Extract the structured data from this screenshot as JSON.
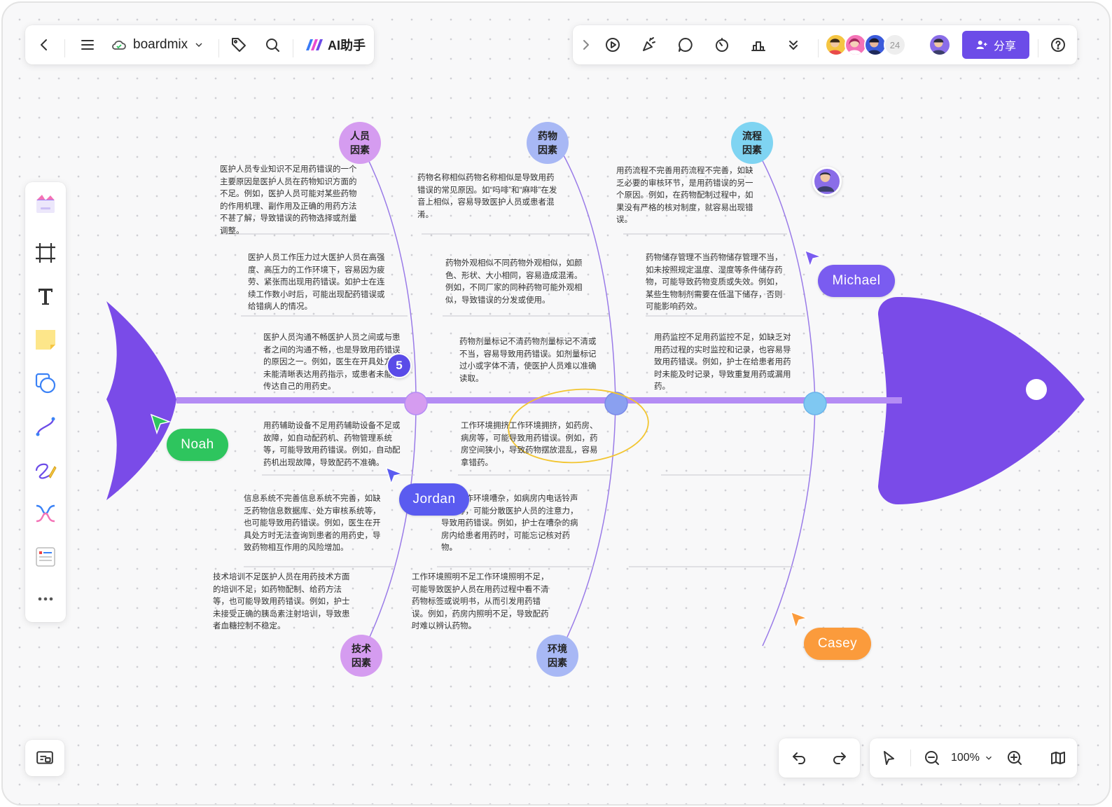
{
  "app": {
    "name": "boardmix",
    "ai_label": "AI助手",
    "share_label": "分享",
    "collaborator_count": "24",
    "accent": "#6c4ce8"
  },
  "colors": {
    "fish": "#7a4be8",
    "spine": "#b48cf4",
    "people": "#d59cf0",
    "drug": "#a8b8f5",
    "process": "#7fd4f2"
  },
  "fishbone": {
    "categories": [
      {
        "label": "人员因素"
      },
      {
        "label": "药物因素"
      },
      {
        "label": "流程因素"
      },
      {
        "label": "技术因素"
      },
      {
        "label": "环境因素"
      }
    ],
    "texts": {
      "p1": "医护人员专业知识不足用药错误的一个主要原因是医护人员在药物知识方面的不足。例如，医护人员可能对某些药物的作用机理、副作用及正确的用药方法不甚了解，导致错误的药物选择或剂量调整。",
      "p2": "医护人员工作压力过大医护人员在高强度、高压力的工作环境下，容易因为疲劳、紧张而出现用药错误。如护士在连续工作数小时后，可能出现配药错误或给错病人的情况。",
      "p3": "医护人员沟通不畅医护人员之间或与患者之间的沟通不畅，也是导致用药错误的原因之一。例如，医生在开具处方时未能清晰表达用药指示，或患者未能确传达自己的用药史。",
      "d1": "药物名称相似药物名称相似是导致用药错误的常见原因。如“吗啡”和“麻啡”在发音上相似，容易导致医护人员或患者混淆。",
      "d2": "药物外观相似不同药物外观相似，如颜色、形状、大小相同，容易造成混淆。例如，不同厂家的同种药物可能外观相似，导致错误的分发或使用。",
      "d3": "药物剂量标记不清药物剂量标记不清或不当，容易导致用药错误。如剂量标记过小或字体不清，使医护人员难以准确读取。",
      "r1": "用药流程不完善用药流程不完善，如缺乏必要的审核环节，是用药错误的另一个原因。例如，在药物配制过程中，如果没有严格的核对制度，就容易出现错误。",
      "r2": "药物储存管理不当药物储存管理不当，如未按照规定温度、湿度等条件储存药物，可能导致药物变质或失效。例如，某些生物制剂需要在低温下储存，否则可能影响药效。",
      "r3": "用药监控不足用药监控不足，如缺乏对用药过程的实时监控和记录，也容易导致用药错误。例如，护士在给患者用药时未能及时记录，导致重复用药或漏用药。",
      "t1": "用药辅助设备不足用药辅助设备不足或故障，如自动配药机、药物管理系统等，可能导致用药错误。例如，自动配药机出现故障，导致配药不准确。",
      "t2": "信息系统不完善信息系统不完善，如缺乏药物信息数据库、处方审核系统等，也可能导致用药错误。例如，医生在开具处方时无法查询到患者的用药史，导致药物相互作用的风险增加。",
      "t3": "技术培训不足医护人员在用药技术方面的培训不足，如药物配制、给药方法等，也可能导致用药错误。例如，护士未接受正确的胰岛素注射培训，导致患者血糖控制不稳定。",
      "e1": "工作环境拥挤工作环境拥挤，如药房、病房等，可能导致用药错误。例如，药房空间狭小，导致药物摆放混乱，容易拿错药。",
      "e2": "嘈杂工作环境嘈杂，如病房内电话铃声不断等，可能分散医护人员的注意力，导致用药错误。例如，护士在嘈杂的病房内给患者用药时，可能忘记核对药物。",
      "e3": "工作环境照明不足工作环境照明不足，可能导致医护人员在用药过程中看不清药物标签或说明书，从而引发用药错误。例如，药房内照明不足，导致配药时难以辨认药物。"
    }
  },
  "cursors": [
    {
      "name": "Noah",
      "color": "#2ec55e"
    },
    {
      "name": "Jordan",
      "color": "#5a5bf0"
    },
    {
      "name": "Michael",
      "color": "#7a5cf0"
    },
    {
      "name": "Casey",
      "color": "#fb9b3c"
    }
  ],
  "comment_count": "5",
  "zoom": "100%"
}
